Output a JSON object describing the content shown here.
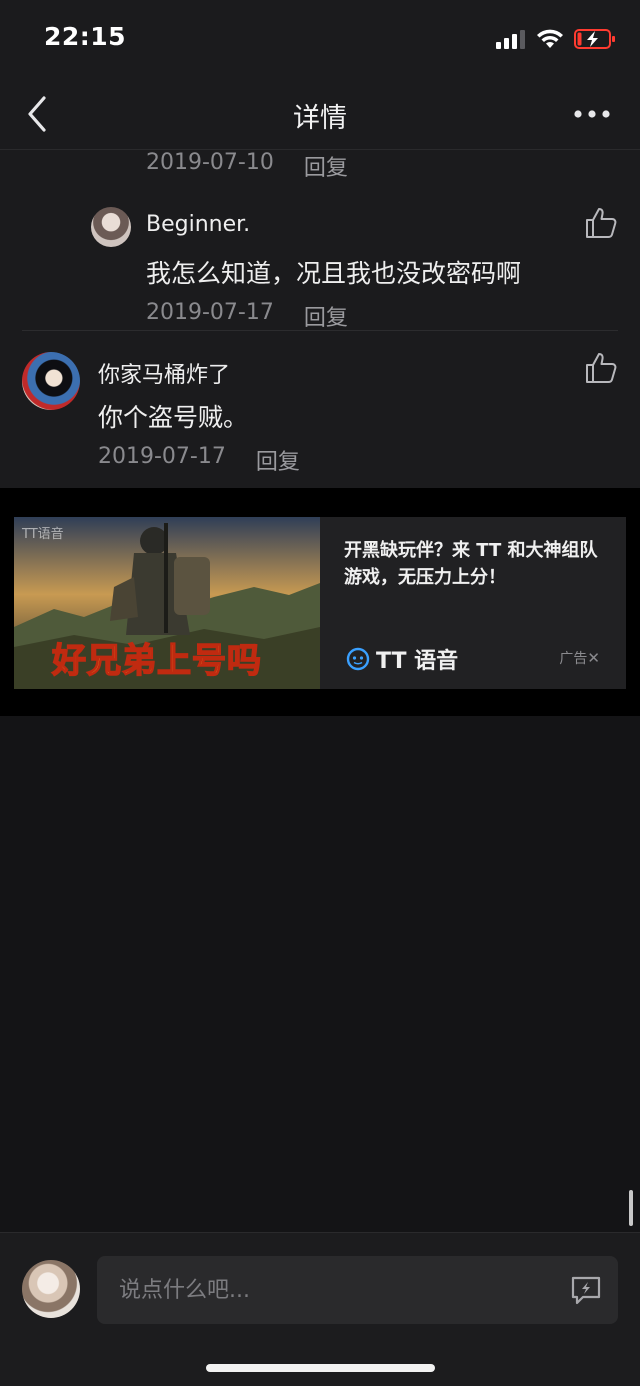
{
  "status": {
    "time": "22:15"
  },
  "nav": {
    "title": "详情"
  },
  "comments": {
    "reply_1_meta": {
      "date": "2019-07-10",
      "reply": "回复"
    },
    "reply_2": {
      "name": "Beginner.",
      "text": "我怎么知道，况且我也没改密码啊",
      "date": "2019-07-17",
      "reply": "回复"
    },
    "comment_3": {
      "name": "你家马桶炸了",
      "text": "你个盗号贼。",
      "date": "2019-07-17",
      "reply": "回复"
    }
  },
  "ad": {
    "image_watermark": "TT语音",
    "image_caption": "好兄弟上号吗",
    "description": "开黑缺玩伴？来 TT 和大神组队游戏，无压力上分！",
    "brand": "TT 语音",
    "label": "广告",
    "close_glyph": "✕"
  },
  "input": {
    "placeholder": "说点什么吧..."
  },
  "colors": {
    "background": "#141416",
    "surface": "#1b1b1d",
    "brand_blue": "#3aa0ff",
    "battery_low": "#ff3b30"
  },
  "icons": [
    "signal-icon",
    "wifi-icon",
    "battery-icon",
    "back-icon",
    "more-icon",
    "like-icon",
    "tt-logo-icon",
    "emoji-icon"
  ]
}
